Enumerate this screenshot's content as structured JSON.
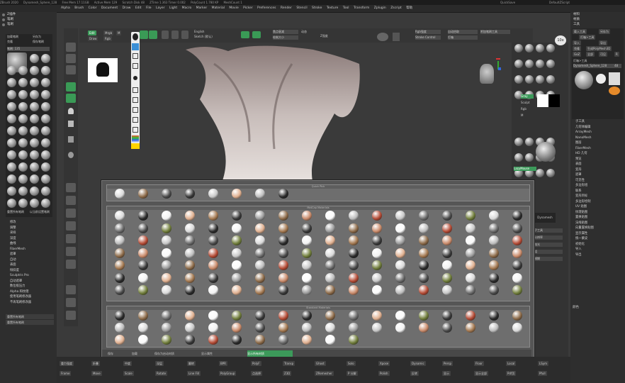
{
  "app": {
    "title_segments": [
      "ZBrush 2020",
      "Dynamesh_Sphere_128",
      "Free Mem 17.11GB",
      "Active Mem 129",
      "Scratch Disk 48",
      "ZTime 1.363 Timer 0.002",
      "PolyCount 1.780 KP",
      "MeshCount 1"
    ],
    "quicksave": "QuickSave",
    "default_script": "DefaultZScript"
  },
  "menus": [
    "Alpha",
    "Brush",
    "Color",
    "Document",
    "Draw",
    "Edit",
    "File",
    "Layer",
    "Light",
    "Macro",
    "Marker",
    "Material",
    "Movie",
    "Picker",
    "Preferences",
    "Render",
    "Stencil",
    "Stroke",
    "Texture",
    "Tool",
    "Transform",
    "Zplugin",
    "Zscript",
    "帮助"
  ],
  "left_panel": {
    "headers": [
      "Z插件",
      "笔刷",
      "笔刷"
    ],
    "brush_count": "笔刷: 135",
    "buttons": [
      "加载笔刷",
      "另存为",
      "克隆",
      "保存笔刷"
    ],
    "bottom_buttons": [
      "重置所有笔刷",
      "以当前设置笔刷"
    ],
    "list": [
      "修改",
      "调整",
      "采样",
      "深度",
      "曲线",
      "FiberMesh",
      "遮罩",
      "自动",
      "表面",
      "倾斜度",
      "Sculptris Pro",
      "自动遮罩",
      "数位板压力",
      "Alpha 和纹理",
      "使用笔刷修改器",
      "不再笔刷修改器"
    ],
    "footer": [
      "重置所有笔刷",
      "重置所有笔刷"
    ]
  },
  "toolbar": {
    "edit_label": "Edit",
    "draw_label": "Draw",
    "english_label": "English",
    "sketch_label": "Sketch (默认)",
    "mrgb": "Mrgb",
    "rgb": "Rgb",
    "m": "M",
    "zadd": "Zadd",
    "zsub": "Zsub",
    "focal_shift": "焦点衰减",
    "draw_size": "绘制大小",
    "z_intensity": "Z强度",
    "rgb_intensity": "Rgb强度",
    "dynamic": "动态",
    "tool_slider": "自动拾取",
    "stroke_label": "Stroke Control",
    "lightbox": "灯箱",
    "spotlight": "附加笔刷工具",
    "zoom_label": "10x"
  },
  "matcap_window": {
    "quick_pick_title": "Quick Pick",
    "matcap_title": "MatCap Materials",
    "standard_title": "Standard Materials",
    "bottom_left": "保存",
    "bottom_mid1": "加载",
    "bottom_mid2": "保存为启动材质",
    "bottom_mid3": "显示属性",
    "bottom_active": "显示所有材质"
  },
  "right_panel": {
    "headers": [
      "材料",
      "材质",
      "工具"
    ],
    "load_tool": "载入工具",
    "save_as": "另存为",
    "import": "导入",
    "export": "导出",
    "clone": "克隆",
    "make_polymesh": "生成PolyMesh3D",
    "goz": "GoZ",
    "all": "全部",
    "visible": "可见",
    "rapid": "R",
    "lightbox_tools": "灯箱>工具",
    "dynamesh_sphere": "Dynamesh_Sphere_128",
    "count": "48",
    "list": [
      "子工具",
      "几何体编辑",
      "ArrayMesh",
      "NanoMesh",
      "图层",
      "FiberMesh",
      "HD 几何",
      "预览",
      "表面",
      "变形",
      "遮罩",
      "可见性",
      "多边形组",
      "联系",
      "变形目标",
      "多边形绘制",
      "UV 贴图",
      "纹理贴图",
      "置换贴图",
      "法线贴图",
      "向量置换贴图",
      "显示属性",
      "统一蒙皮",
      "初始化",
      "导入",
      "导出"
    ],
    "tail": "颜色"
  },
  "right_column": {
    "label_gray": "Gray",
    "label_sculpt": "Sculpt",
    "label_rgb": "Rgb",
    "label_m": "M",
    "label_lazymouse": "LazyMouse",
    "dynamesh": "Dynamesh",
    "subtool_btn": "子工具",
    "resolution": "分辨率",
    "polish": "抛光",
    "groups": "组",
    "blur": "模糊"
  },
  "bottom_bar": {
    "items": [
      "重力强度",
      "折叠",
      "中度",
      "深层",
      "翻转",
      "BPR",
      "PolyF",
      "Transp",
      "Ghost",
      "Solo",
      "Xpose",
      "Dynamic",
      "Persp",
      "Floor",
      "Local",
      "LSym",
      "Frame",
      "Move",
      "Scale",
      "Rotate",
      "Line Fill",
      "PolyGroup",
      "点选择",
      "Z3D",
      "ZRemesher",
      "P 分解",
      "Polish",
      "反转",
      "显示",
      "显示全部",
      "Pdf页",
      "Pfull"
    ]
  },
  "colors": {
    "accent_green": "#3c9a5a",
    "ui_dark": "#2e2e2e",
    "viewport": "#3a3a3a"
  }
}
